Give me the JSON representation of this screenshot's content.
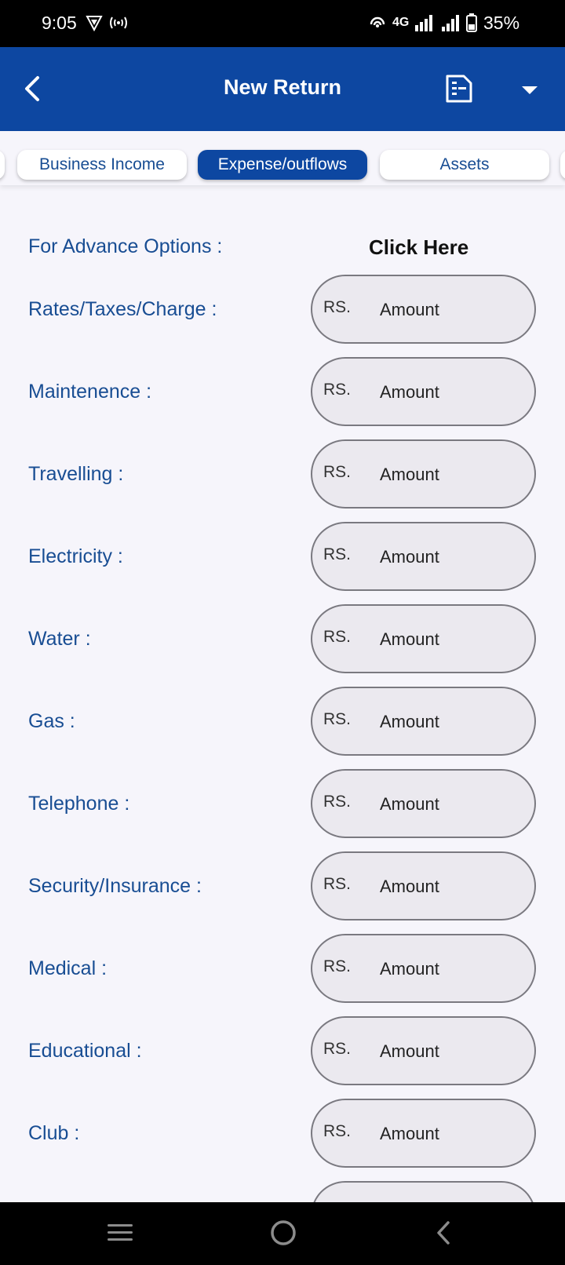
{
  "status_bar": {
    "time": "9:05",
    "network": "4G",
    "battery": "35%"
  },
  "app_bar": {
    "title": "New Return",
    "back_icon": "chevron-left-icon",
    "doc_icon": "document-icon",
    "dropdown_icon": "caret-down-icon"
  },
  "tabs": [
    {
      "label": "",
      "active": false
    },
    {
      "label": "Business Income",
      "active": false
    },
    {
      "label": "Expense/outflows",
      "active": true
    },
    {
      "label": "Assets",
      "active": false
    },
    {
      "label": "",
      "active": false
    }
  ],
  "form": {
    "advance_label": "For Advance Options :",
    "advance_link": "Click Here",
    "currency_prefix": "RS.",
    "placeholder": "Amount",
    "fields": [
      {
        "label": "Rates/Taxes/Charge :"
      },
      {
        "label": "Maintenence :"
      },
      {
        "label": "Travelling :"
      },
      {
        "label": "Electricity :"
      },
      {
        "label": "Water :"
      },
      {
        "label": "Gas :"
      },
      {
        "label": "Telephone :"
      },
      {
        "label": "Security/Insurance :"
      },
      {
        "label": "Medical :"
      },
      {
        "label": "Educational :"
      },
      {
        "label": "Club :"
      }
    ]
  },
  "nav_bar": {
    "recents_icon": "recents-icon",
    "home_icon": "home-icon",
    "back_icon": "back-icon"
  },
  "colors": {
    "primary": "#0d47a1",
    "label": "#184d93",
    "background": "#f6f5fb",
    "field_fill": "#ebe9ef",
    "field_border": "#7a7980"
  }
}
